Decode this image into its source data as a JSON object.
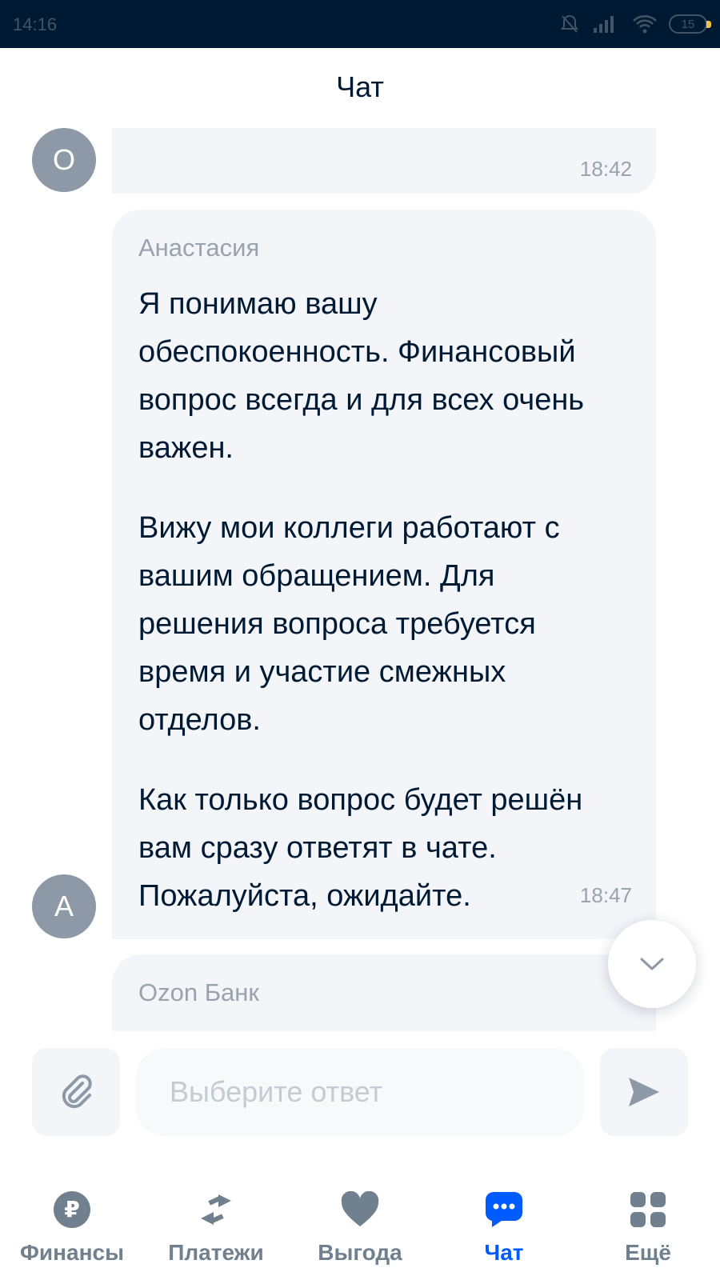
{
  "status_bar": {
    "time": "14:16",
    "battery": "15"
  },
  "header": {
    "title": "Чат"
  },
  "messages": [
    {
      "avatar_letter": "О",
      "time": "18:42"
    },
    {
      "avatar_letter": "А",
      "sender": "Анастасия",
      "paragraphs": [
        [
          "Я понимаю вашу",
          "обеспокоенность. Финансовый",
          "вопрос всегда и для всех очень",
          "важен."
        ],
        [
          "Вижу мои коллеги работают с",
          "вашим обращением. Для",
          "решения вопроса требуется",
          "время и участие смежных",
          "отделов."
        ],
        [
          "Как только вопрос будет решён",
          "вам сразу ответят в чате.",
          "Пожалуйста, ожидайте."
        ]
      ],
      "time": "18:47"
    },
    {
      "sender": "Ozon Банк"
    }
  ],
  "composer": {
    "placeholder": "Выберите ответ"
  },
  "tabs": [
    {
      "label": "Финансы",
      "icon": "ruble-icon",
      "active": false
    },
    {
      "label": "Платежи",
      "icon": "transfer-arrows-icon",
      "active": false
    },
    {
      "label": "Выгода",
      "icon": "heart-icon",
      "active": false
    },
    {
      "label": "Чат",
      "icon": "chat-icon",
      "active": true
    },
    {
      "label": "Ещё",
      "icon": "grid-icon",
      "active": false
    }
  ],
  "colors": {
    "accent": "#005bff",
    "status_bar": "#001a34",
    "bubble": "#f3f5f9",
    "avatar": "#8d99a6",
    "tab_inactive": "#70808f"
  }
}
